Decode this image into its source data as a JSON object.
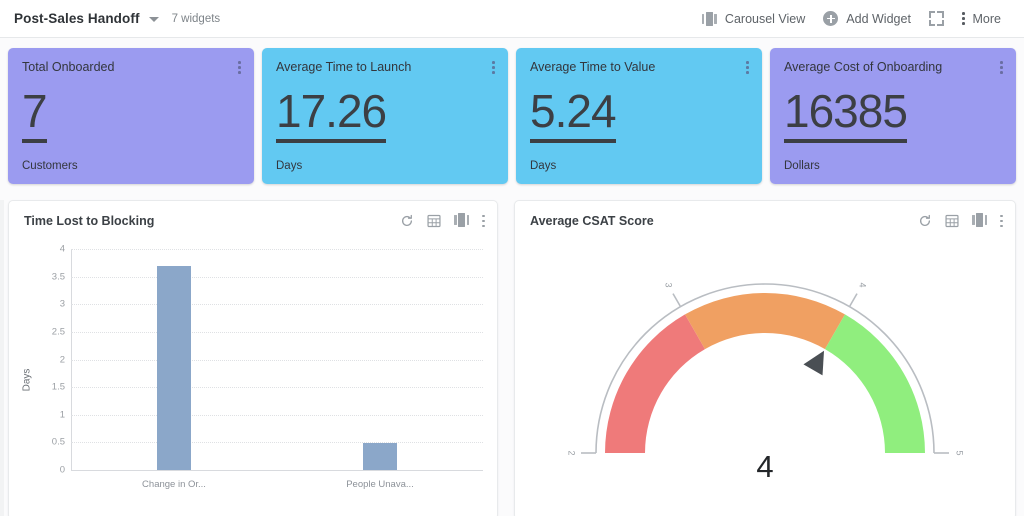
{
  "header": {
    "dashboard_title": "Post-Sales Handoff",
    "widget_count": "7 widgets",
    "caret_icon": "chevron-down-icon",
    "actions": [
      {
        "label": "Carousel View",
        "icon": "carousel-icon"
      },
      {
        "label": "Add Widget",
        "icon": "plus-circle-icon"
      },
      {
        "label": "",
        "icon": "expand-icon"
      },
      {
        "label": "More",
        "icon": "kebab-icon"
      }
    ]
  },
  "kpis": [
    {
      "title": "Total Onboarded",
      "value": "7",
      "unit": "Customers",
      "bg": "#9b9bf0",
      "menu_icon": "kebab-icon"
    },
    {
      "title": "Average Time to Launch",
      "value": "17.26",
      "unit": "Days",
      "bg": "#62c9f2",
      "menu_icon": "kebab-icon"
    },
    {
      "title": "Average Time to Value",
      "value": "5.24",
      "unit": "Days",
      "bg": "#62c9f2",
      "menu_icon": "kebab-icon"
    },
    {
      "title": "Average Cost of Onboarding",
      "value": "16385",
      "unit": "Dollars",
      "bg": "#9b9bf0",
      "menu_icon": "kebab-icon"
    }
  ],
  "widgets": {
    "bar": {
      "title": "Time Lost to Blocking",
      "tools": [
        "refresh-icon",
        "table-view-icon",
        "carousel-icon",
        "kebab-icon"
      ]
    },
    "gauge": {
      "title": "Average CSAT Score",
      "tools": [
        "refresh-icon",
        "table-view-icon",
        "carousel-icon",
        "kebab-icon"
      ]
    }
  },
  "chart_data": [
    {
      "type": "bar",
      "title": "Time Lost to Blocking",
      "categories": [
        "Change in Or...",
        "People Unava..."
      ],
      "values": [
        3.7,
        0.48
      ],
      "xlabel": "",
      "ylabel": "Days",
      "ylim": [
        0,
        4
      ],
      "yticks": [
        0,
        0.5,
        1,
        1.5,
        2,
        2.5,
        3,
        3.5,
        4
      ],
      "ytick_labels": [
        "0",
        "0.5",
        "1",
        "1.5",
        "2",
        "2.5",
        "3",
        "3.5",
        "4"
      ],
      "grid": true,
      "legend": false,
      "bar_color": "#8ba7c9"
    },
    {
      "type": "gauge",
      "title": "Average CSAT Score",
      "value": 4,
      "value_label": "4",
      "min": 2,
      "max": 5,
      "ticks": [
        2,
        3,
        4,
        5
      ],
      "tick_labels": [
        "2",
        "3",
        "4",
        "5"
      ],
      "bands": [
        {
          "from": 2,
          "to": 3,
          "color": "#ef7a7a"
        },
        {
          "from": 3,
          "to": 4,
          "color": "#f0a062"
        },
        {
          "from": 4,
          "to": 5,
          "color": "#90ee7e"
        }
      ],
      "needle_color": "#4a4f54",
      "needle_value": 4
    }
  ]
}
